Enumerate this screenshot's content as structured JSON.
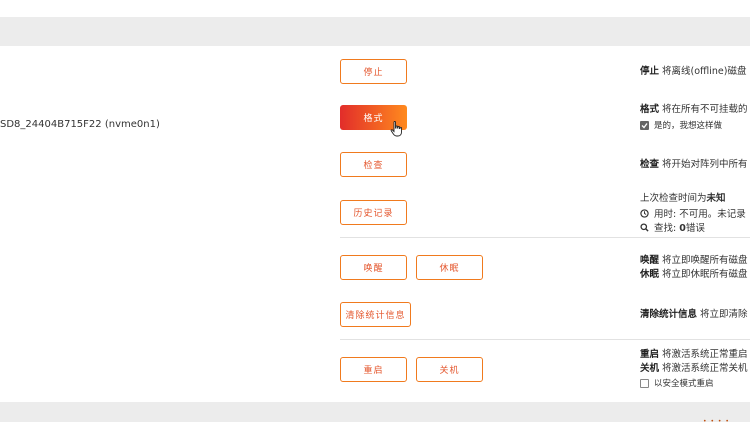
{
  "device": {
    "name": "SD8_24404B715F22 (nvme0n1)"
  },
  "buttons": {
    "stop": "停止",
    "format": "格式",
    "check": "检查",
    "history": "历史记录",
    "wake": "唤醒",
    "sleep": "休眠",
    "clear_stats": "清除统计信息",
    "reboot": "重启",
    "shutdown": "关机"
  },
  "descriptions": {
    "stop": {
      "bold": "停止",
      "text": " 将离线(offline)磁盘"
    },
    "format": {
      "bold": "格式",
      "text": " 将在所有不可挂载的",
      "confirm_label": "是的，我想这样做"
    },
    "check": {
      "bold": "检查",
      "text": " 将开始对阵列中所有"
    },
    "history": {
      "last_check_prefix": "上次检查时间为",
      "last_check_value": "未知",
      "used_time": "用时: 不可用。未记录",
      "found_prefix": "查找: ",
      "found_value": "0",
      "found_suffix": "错误"
    },
    "wake": {
      "bold": "唤醒",
      "text": " 将立即唤醒所有磁盘"
    },
    "sleep": {
      "bold": "休眠",
      "text": " 将立即休眠所有磁盘"
    },
    "clear_stats": {
      "bold": "清除统计信息",
      "text": " 将立即清除"
    },
    "reboot": {
      "bold": "重启",
      "text": " 将激活系统正常重启"
    },
    "shutdown": {
      "bold": "关机",
      "text": " 将激活系统正常关机"
    },
    "safe_mode": {
      "label": "以安全模式重启"
    }
  },
  "status": {
    "loader": "• • • •"
  },
  "icons": {
    "clock": "clock-icon",
    "search": "search-icon",
    "cursor": "hand-pointer-icon",
    "checkbox": "checkbox-icon"
  },
  "colors": {
    "accent_orange": "#f07a1e",
    "accent_red": "#e4572e",
    "header_band": "#ececec"
  }
}
